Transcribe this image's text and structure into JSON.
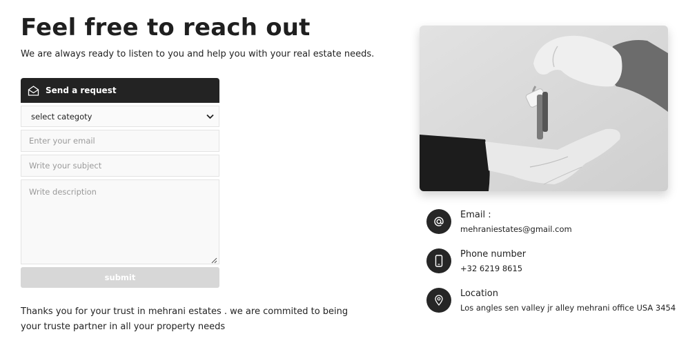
{
  "header": {
    "title": "Feel free to reach out",
    "subtitle": "We are always ready to listen to you and help you with your real estate needs."
  },
  "form": {
    "header_label": "Send a request",
    "category_selected": "select categoty",
    "email_placeholder": "Enter your email",
    "subject_placeholder": "Write your subject",
    "description_placeholder": "Write description",
    "submit_label": "submit"
  },
  "footer_note": "Thanks you for your trust in mehrani estates . we are commited to being your truste partner in all your property needs",
  "contacts": {
    "email": {
      "label": "Email :",
      "value": "mehraniestates@gmail.com",
      "icon": "at-sign-icon"
    },
    "phone": {
      "label": "Phone number",
      "value": "+32 6219 8615",
      "icon": "phone-icon"
    },
    "location": {
      "label": "Location",
      "value": "Los angles sen valley jr alley mehrani office USA 3454",
      "icon": "location-pin-icon"
    }
  },
  "colors": {
    "dark": "#232323",
    "submit_disabled": "#d7d7d7",
    "field_border": "#e3e3e3"
  }
}
